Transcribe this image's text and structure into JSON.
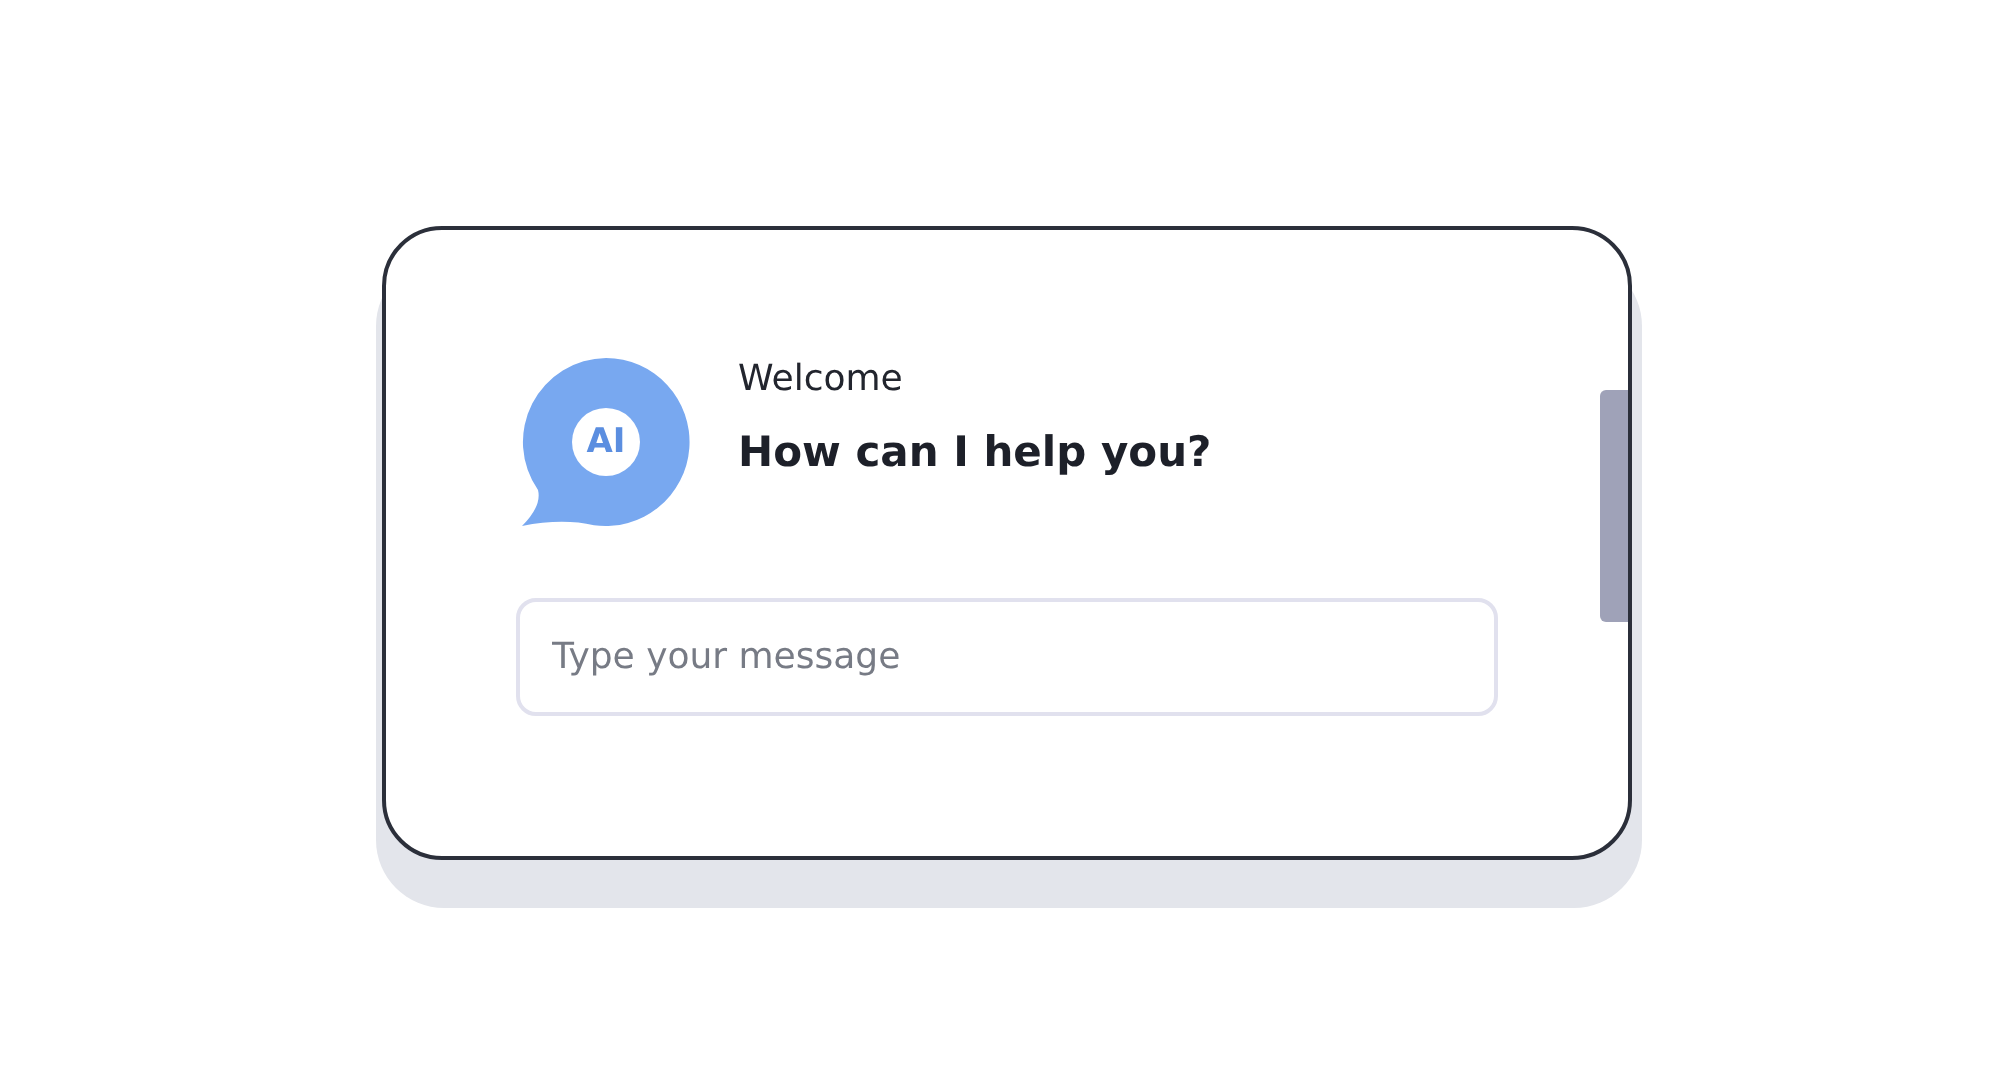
{
  "chat": {
    "avatar_label": "AI",
    "greeting": "Welcome",
    "prompt": "How can I help you?"
  },
  "message_input": {
    "placeholder": "Type your message"
  }
}
